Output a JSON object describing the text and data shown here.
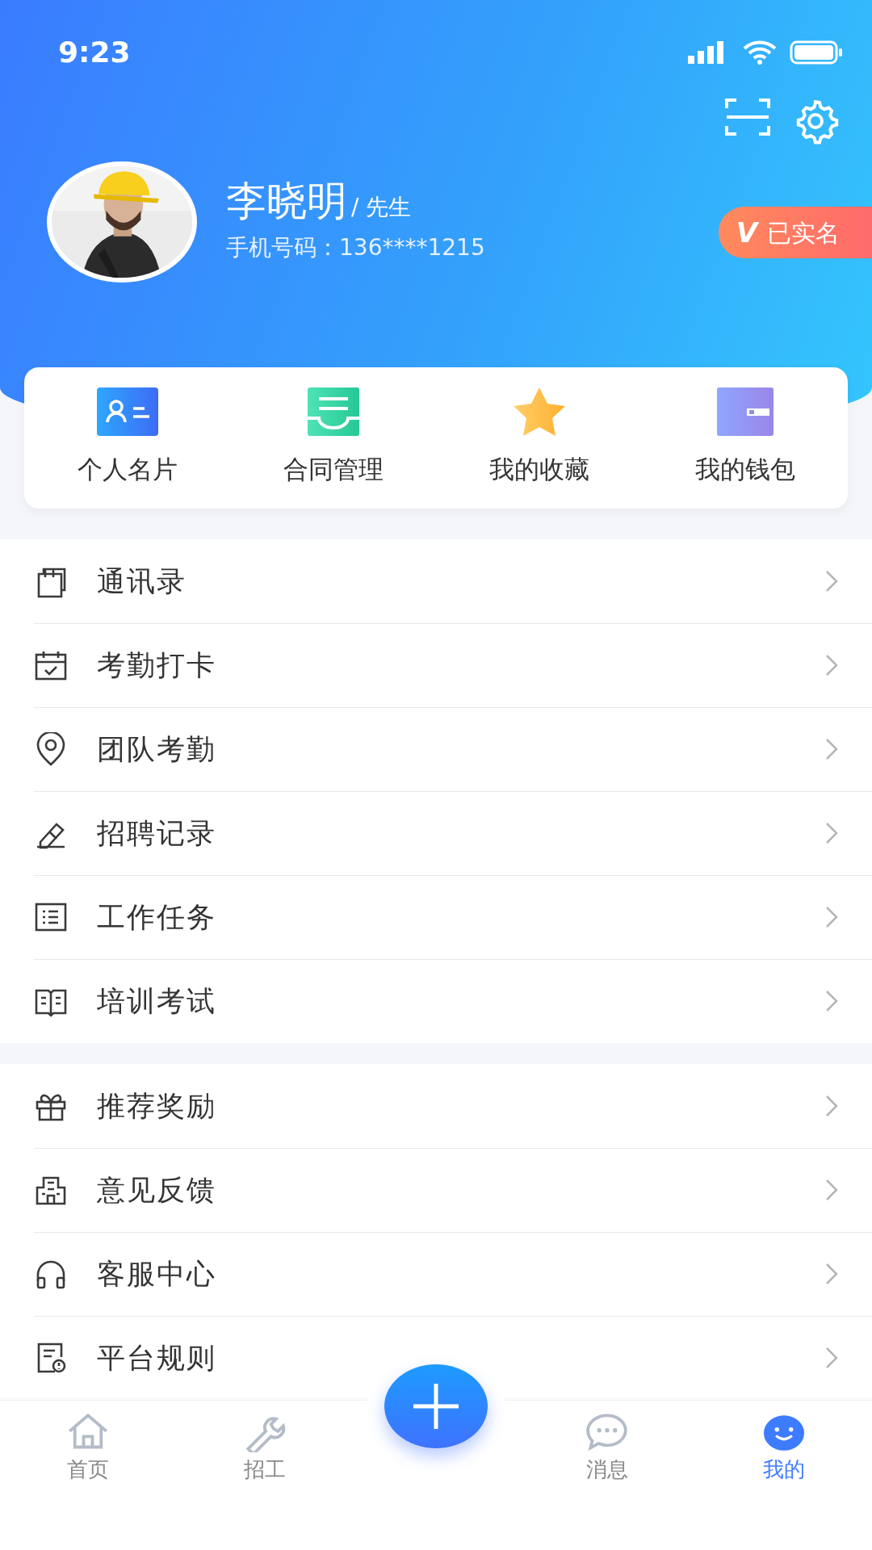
{
  "status_bar": {
    "time": "9:23"
  },
  "profile": {
    "name": "李晓明",
    "title": "/ 先生",
    "phone": "手机号码：136****1215",
    "verified_badge": "已实名",
    "verified_mark": "V"
  },
  "shortcuts": [
    {
      "label": "个人名片"
    },
    {
      "label": "合同管理"
    },
    {
      "label": "我的收藏"
    },
    {
      "label": "我的钱包"
    }
  ],
  "menu_groups": [
    {
      "items": [
        {
          "label": "通讯录"
        },
        {
          "label": "考勤打卡"
        },
        {
          "label": "团队考勤"
        },
        {
          "label": "招聘记录"
        },
        {
          "label": "工作任务"
        },
        {
          "label": "培训考试"
        }
      ]
    },
    {
      "items": [
        {
          "label": "推荐奖励"
        },
        {
          "label": "意见反馈"
        },
        {
          "label": "客服中心"
        },
        {
          "label": "平台规则"
        }
      ]
    }
  ],
  "tab_bar": [
    {
      "kind": "tab",
      "label": "首页",
      "selected": false
    },
    {
      "kind": "tab",
      "label": "招工",
      "selected": false
    },
    {
      "kind": "add"
    },
    {
      "kind": "tab",
      "label": "消息",
      "selected": false
    },
    {
      "kind": "tab",
      "label": "我的",
      "selected": true
    }
  ]
}
